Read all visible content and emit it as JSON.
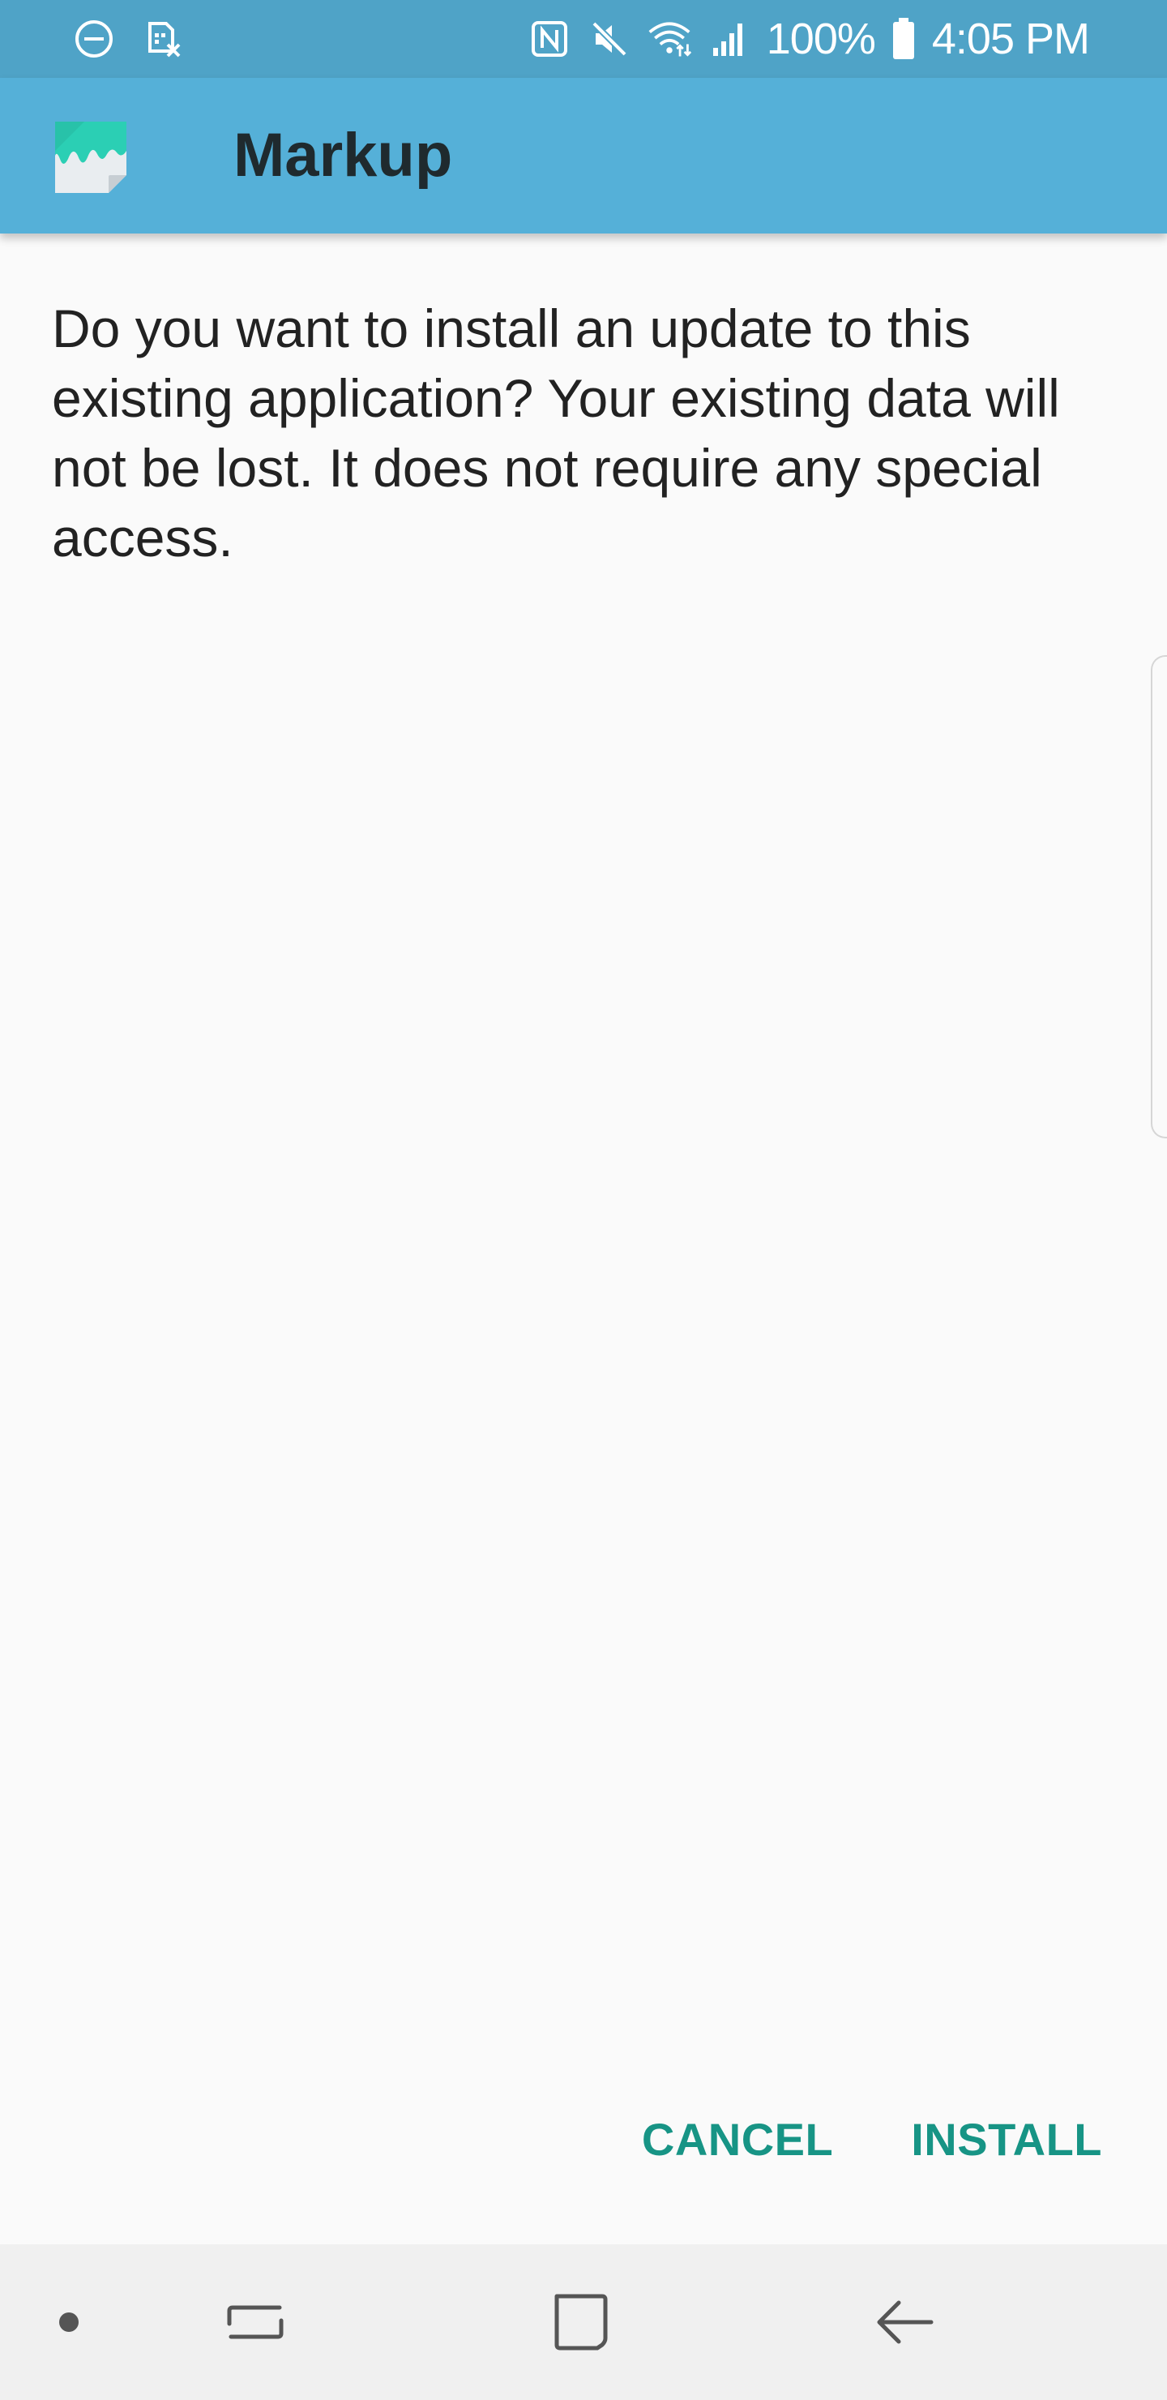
{
  "status_bar": {
    "battery": "100%",
    "time": "4:05 PM",
    "icons": [
      "do-not-disturb-icon",
      "sim-card-icon",
      "nfc-icon",
      "mute-icon",
      "wifi-icon",
      "signal-icon",
      "battery-icon"
    ]
  },
  "app_bar": {
    "title": "Markup",
    "icon": "markup-app-icon"
  },
  "dialog": {
    "message": "Do you want to install an update to this existing application? Your existing data will not be lost. It does not require any special access.",
    "cancel_label": "CANCEL",
    "install_label": "INSTALL"
  },
  "nav_bar": {
    "items": [
      "dot-icon",
      "recents-icon",
      "home-icon",
      "back-icon"
    ]
  },
  "colors": {
    "status_bar": "#4fa3c7",
    "app_bar": "#55b0d8",
    "accent": "#179485",
    "background": "#fafafa",
    "nav_bar": "#f0f0f0"
  }
}
